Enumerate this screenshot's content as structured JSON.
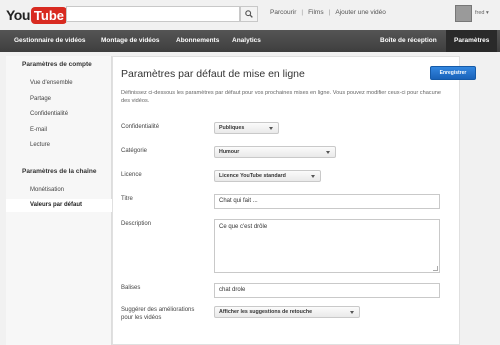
{
  "header": {
    "logo_you": "You",
    "logo_tube": "Tube",
    "search_value": "",
    "links": [
      "Parcourir",
      "Films",
      "Ajouter une vidéo"
    ],
    "username": "fred"
  },
  "nav": {
    "items": [
      "Gestionnaire de vidéos",
      "Montage de vidéos",
      "Abonnements",
      "Analytics",
      "Boîte de réception",
      "Paramètres"
    ],
    "active": "Paramètres"
  },
  "sidebar": {
    "account_heading": "Paramètres de compte",
    "account_items": [
      "Vue d'ensemble",
      "Partage",
      "Confidentialité",
      "E-mail",
      "Lecture"
    ],
    "channel_heading": "Paramètres de la chaîne",
    "channel_items": [
      "Monétisation",
      "Valeurs par défaut"
    ],
    "selected": "Valeurs par défaut"
  },
  "main": {
    "title": "Paramètres par défaut de mise en ligne",
    "save_label": "Enregistrer",
    "intro": "Définissez ci-dessous les paramètres par défaut pour vos prochaines mises en ligne. Vous pouvez modifier ceux-ci pour chacune des vidéos.",
    "privacy": {
      "label": "Confidentialité",
      "value": "Publiques"
    },
    "category": {
      "label": "Catégorie",
      "value": "Humour"
    },
    "license": {
      "label": "Licence",
      "value": "Licence YouTube standard"
    },
    "title_field": {
      "label": "Titre",
      "value": "Chat qui fait ..."
    },
    "description": {
      "label": "Description",
      "value": "Ce que c'est drôle"
    },
    "tags": {
      "label": "Balises",
      "value": "chat drole"
    },
    "enhance": {
      "label": "Suggérer des améliorations pour les vidéos",
      "value": "Afficher les suggestions de retouche"
    }
  },
  "colors": {
    "accent": "#1a62b9",
    "nav": "#444444",
    "logo_red": "#d82a20"
  }
}
